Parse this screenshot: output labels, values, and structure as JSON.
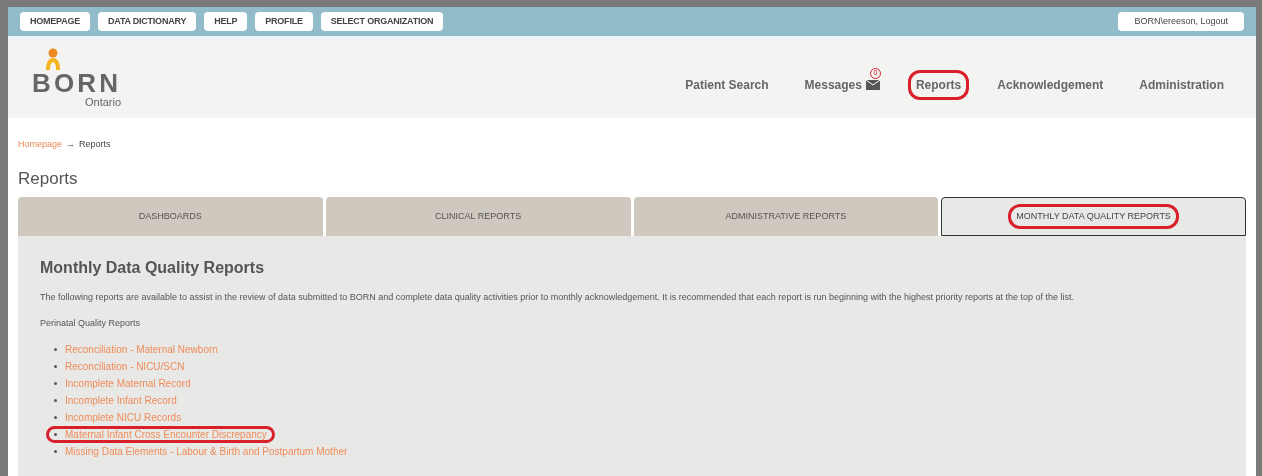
{
  "top_buttons": [
    "HOMEPAGE",
    "DATA DICTIONARY",
    "HELP",
    "PROFILE",
    "SELECT ORGANIZATION"
  ],
  "user_button": "BORN\\ereeson, Logout",
  "logo": {
    "name": "BORN",
    "region": "Ontario"
  },
  "nav": [
    {
      "label": "Patient Search",
      "annotated": false
    },
    {
      "label": "Messages",
      "badge": "0",
      "annotated": false
    },
    {
      "label": "Reports",
      "annotated": true
    },
    {
      "label": "Acknowledgement",
      "annotated": false
    },
    {
      "label": "Administration",
      "annotated": false
    }
  ],
  "breadcrumb": {
    "link": "Homepage",
    "separator": "→",
    "current": "Reports"
  },
  "page_title": "Reports",
  "tabs": [
    {
      "label": "DASHBOARDS",
      "selected": false,
      "annotated": false
    },
    {
      "label": "CLINICAL REPORTS",
      "selected": false,
      "annotated": false
    },
    {
      "label": "ADMINISTRATIVE REPORTS",
      "selected": false,
      "annotated": false
    },
    {
      "label": "MONTHLY DATA QUALITY REPORTS",
      "selected": true,
      "annotated": true
    }
  ],
  "panel": {
    "title": "Monthly Data Quality Reports",
    "description": "The following reports are available to assist in the review of data submitted to BORN and complete data quality activities prior to monthly acknowledgement. It is recommended that each report is run beginning with the highest priority reports at the top of the list.",
    "section": "Perinatal Quality Reports",
    "reports": [
      {
        "label": "Reconciliation - Maternal Newborn",
        "annotated": false
      },
      {
        "label": "Reconciliation - NICU/SCN",
        "annotated": false
      },
      {
        "label": "Incomplete Maternal Record",
        "annotated": false
      },
      {
        "label": "Incomplete Infant Record",
        "annotated": false
      },
      {
        "label": "Incomplete NICU Records",
        "annotated": false
      },
      {
        "label": "Maternal Infant Cross Encounter Discrepancy",
        "annotated": true
      },
      {
        "label": "Missing Data Elements - Labour & Birth and Postpartum Mother",
        "annotated": false
      }
    ]
  }
}
